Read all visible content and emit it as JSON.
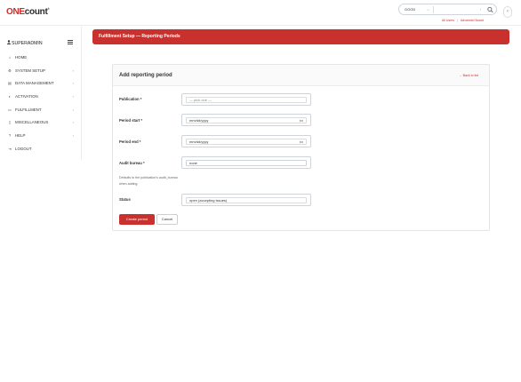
{
  "brand": {
    "one": "ONE",
    "count": "count",
    "reg": "®"
  },
  "search": {
    "scope_value": "GOOD",
    "query_value": "",
    "shortcut_hint": "/"
  },
  "top_links": {
    "all_users": "All Users",
    "admin_board": "Advanced Board"
  },
  "sidebar": {
    "user_label": "SUPERADMIN",
    "items": [
      {
        "label": "HOME",
        "icon": "home-icon",
        "glyph": "⌂",
        "has_submenu": false
      },
      {
        "label": "SYSTEM SETUP",
        "icon": "gear-icon",
        "glyph": "⚙",
        "has_submenu": true
      },
      {
        "label": "DATA MANAGEMENT",
        "icon": "database-icon",
        "glyph": "▤",
        "has_submenu": true
      },
      {
        "label": "ACTIVATION",
        "icon": "toggle-icon",
        "glyph": "◐",
        "has_submenu": true
      },
      {
        "label": "FULFILLMENT",
        "icon": "truck-icon",
        "glyph": "▭",
        "has_submenu": true
      },
      {
        "label": "MISCELLANEOUS",
        "icon": "file-icon",
        "glyph": "▯",
        "has_submenu": true
      },
      {
        "label": "HELP",
        "icon": "help-icon",
        "glyph": "?",
        "has_submenu": true
      },
      {
        "label": "LOGOUT",
        "icon": "logout-icon",
        "glyph": "⇥",
        "has_submenu": false
      }
    ],
    "submenu_glyph": "›"
  },
  "page": {
    "header_title": "Fulfillment Setup — Reporting Periods"
  },
  "form": {
    "title": "Add reporting period",
    "back_link": "← Back to list",
    "fields": {
      "publication": {
        "label": "Publication *",
        "placeholder": "— pick one —"
      },
      "period_start": {
        "label": "Period start *",
        "value": "mm/dd/yyyy"
      },
      "period_end": {
        "label": "Period end *",
        "value": "mm/dd/yyyy"
      },
      "audit_bureau": {
        "label": "Audit bureau *",
        "value": "none",
        "help": "Defaults to the publication's audit_bureau when adding."
      },
      "status": {
        "label": "Status",
        "value": "open (accepting issues)"
      }
    },
    "submit_label": "Create period",
    "cancel_label": "Cancel"
  },
  "colors": {
    "accent": "#c8312d",
    "brand_red": "#d42a2a"
  }
}
